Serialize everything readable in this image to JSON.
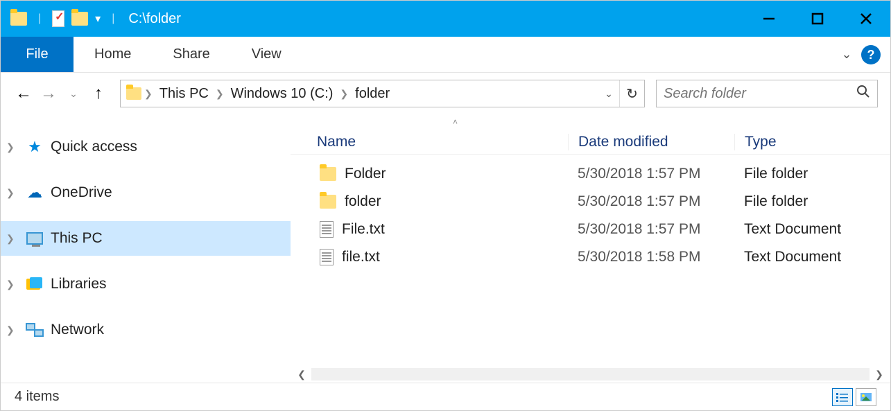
{
  "titlebar": {
    "title": "C:\\folder"
  },
  "ribbon": {
    "file": "File",
    "tabs": [
      "Home",
      "Share",
      "View"
    ]
  },
  "address": {
    "crumbs": [
      "This PC",
      "Windows 10 (C:)",
      "folder"
    ]
  },
  "search": {
    "placeholder": "Search folder"
  },
  "navpane": {
    "items": [
      {
        "label": "Quick access",
        "icon": "star"
      },
      {
        "label": "OneDrive",
        "icon": "cloud"
      },
      {
        "label": "This PC",
        "icon": "monitor",
        "selected": true
      },
      {
        "label": "Libraries",
        "icon": "libraries"
      },
      {
        "label": "Network",
        "icon": "network"
      }
    ]
  },
  "columns": {
    "name": "Name",
    "date": "Date modified",
    "type": "Type"
  },
  "files": [
    {
      "name": "Folder",
      "date": "5/30/2018 1:57 PM",
      "type": "File folder",
      "icon": "folder"
    },
    {
      "name": "folder",
      "date": "5/30/2018 1:57 PM",
      "type": "File folder",
      "icon": "folder"
    },
    {
      "name": "File.txt",
      "date": "5/30/2018 1:57 PM",
      "type": "Text Document",
      "icon": "txt"
    },
    {
      "name": "file.txt",
      "date": "5/30/2018 1:58 PM",
      "type": "Text Document",
      "icon": "txt"
    }
  ],
  "status": {
    "count": "4 items"
  }
}
